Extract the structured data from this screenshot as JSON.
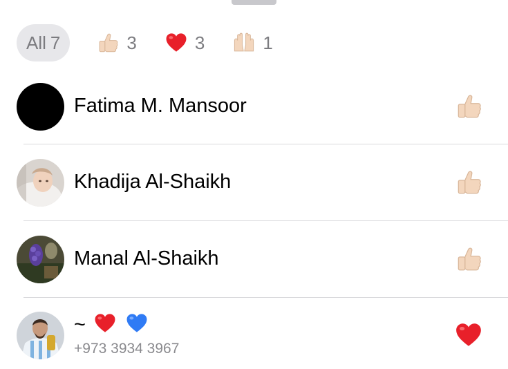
{
  "tabs": [
    {
      "label": "All",
      "count": "7",
      "icon": ""
    },
    {
      "label": "",
      "count": "3",
      "icon": "thumbs-up-icon"
    },
    {
      "label": "",
      "count": "3",
      "icon": "red-heart-icon"
    },
    {
      "label": "",
      "count": "1",
      "icon": "raised-hands-icon"
    }
  ],
  "reactors": [
    {
      "name": "Fatima M. Mansoor",
      "subtitle": "",
      "avatar": "black-avatar",
      "reaction": "thumbs-up-icon"
    },
    {
      "name": "Khadija Al-Shaikh",
      "subtitle": "",
      "avatar": "baby-photo-avatar",
      "reaction": "thumbs-up-icon"
    },
    {
      "name": "Manal Al-Shaikh",
      "subtitle": "",
      "avatar": "flower-photo-avatar",
      "reaction": "thumbs-up-icon"
    },
    {
      "name": "~",
      "name_emojis": [
        "red-heart-icon",
        "blue-heart-icon"
      ],
      "subtitle": "+973 3934 3967",
      "avatar": "football-photo-avatar",
      "reaction": "red-heart-icon"
    }
  ],
  "colors": {
    "tab_active_bg": "#e7e7ea",
    "secondary_text": "#7c7c80",
    "divider": "#d9d9dc",
    "heart_red": "#e8202a",
    "heart_blue": "#2f7bf5",
    "skin_tone": "#f3d6bd"
  }
}
